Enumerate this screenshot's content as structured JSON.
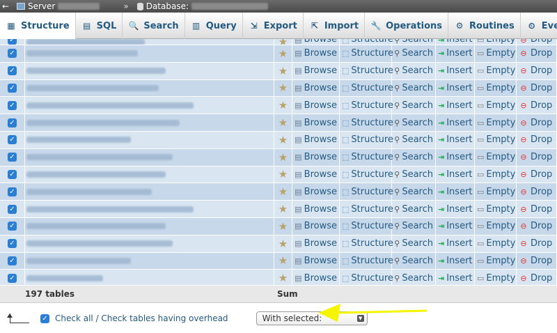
{
  "topbar": {
    "back_symbol": "←",
    "server_label": "Server",
    "separator": "»",
    "database_label": "Database:"
  },
  "tabs": [
    {
      "label": "Structure",
      "icon": "structure-icon",
      "glyph": "▦"
    },
    {
      "label": "SQL",
      "icon": "sql-icon",
      "glyph": "▤"
    },
    {
      "label": "Search",
      "icon": "search-icon",
      "glyph": "🔍"
    },
    {
      "label": "Query",
      "icon": "query-icon",
      "glyph": "▥"
    },
    {
      "label": "Export",
      "icon": "export-icon",
      "glyph": "⇲"
    },
    {
      "label": "Import",
      "icon": "import-icon",
      "glyph": "⇱"
    },
    {
      "label": "Operations",
      "icon": "operations-icon",
      "glyph": "🔧"
    },
    {
      "label": "Routines",
      "icon": "routines-icon",
      "glyph": "⚙"
    },
    {
      "label": "Events",
      "icon": "events-icon",
      "glyph": "⏲"
    }
  ],
  "actions": {
    "browse": "Browse",
    "structure": "Structure",
    "search": "Search",
    "insert": "Insert",
    "empty": "Empty",
    "drop": "Drop"
  },
  "summary": {
    "count": "197 tables",
    "sum": "Sum"
  },
  "bottom": {
    "checkall": "Check all / Check tables having overhead",
    "with_selected": "With selected:"
  },
  "colors": {
    "link": "#235a81",
    "row_a": "#d9e6f2",
    "row_b": "#c7d8ea",
    "highlight_arrow": "#f5f500"
  }
}
